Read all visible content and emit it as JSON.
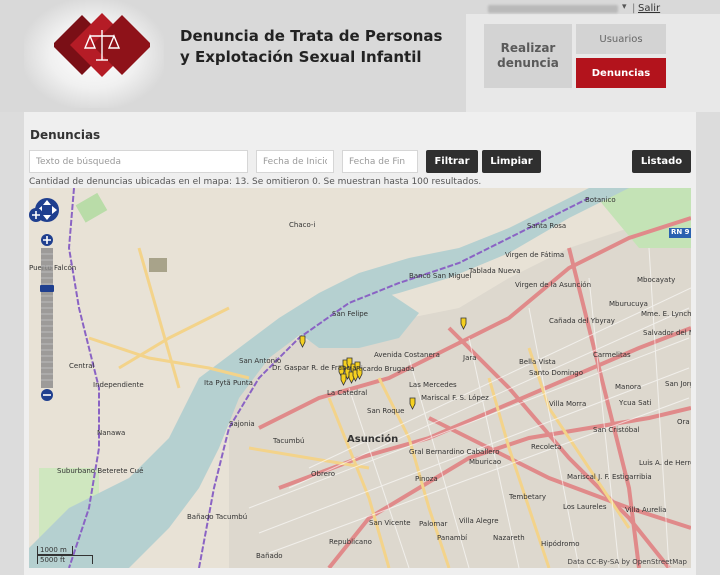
{
  "header": {
    "title_line1": "Denuncia de Trata de Personas",
    "title_line2": "y Explotación Sexual Infantil",
    "logout_label": "Salir",
    "separator": "|",
    "caret": "▾"
  },
  "nav": {
    "realizar_line1": "Realizar",
    "realizar_line2": "denuncia",
    "usuarios_label": "Usuarios",
    "denuncias_label": "Denuncias",
    "active_color": "#b3131c"
  },
  "page": {
    "title": "Denuncias",
    "search_placeholder": "Texto de búsqueda",
    "start_placeholder": "Fecha de Inicio",
    "end_placeholder": "Fecha de Fin",
    "filter_label": "Filtrar",
    "clear_label": "Limpiar",
    "list_label": "Listado",
    "info_text": "Cantidad de denuncias ubicadas en el mapa: 13. Se omitieron 0. Se muestran hasta 100 resultados."
  },
  "map": {
    "labels": {
      "asuncion": "Asunción",
      "botanico": "Botanico",
      "santa_rosa": "Santa Rosa",
      "chaco_i": "Chaco-i",
      "banco_san_miguel": "Banco San Miguel",
      "tablada_nueva": "Tablada Nueva",
      "virgen_fatima": "Virgen de Fátima",
      "virgen_asuncion": "Virgen de la Asunción",
      "mburucuya": "Mburucuya",
      "san_felipe": "San Felipe",
      "san_antonio": "San Antonio",
      "gaspar": "Dr. Gaspar R. de Francia",
      "ricardo_brugada": "Ricardo Brugada",
      "la_catedral": "La Catedral",
      "san_roque": "San Roque",
      "las_mercedes": "Las Mercedes",
      "jara": "Jara",
      "bella_vista": "Bella Vista",
      "santo_domingo": "Santo Domingo",
      "carmelitas": "Carmelitas",
      "manora": "Manora",
      "villa_morra": "Villa Morra",
      "ycua_sati": "Ycua Sati",
      "recoleta": "Recoleta",
      "san_cristobal": "San Cristóbal",
      "sajonia": "Sajonia",
      "tacumbu": "Tacumbú",
      "obrero": "Obrero",
      "pinoza": "Pinoza",
      "mburicao": "Mburicao",
      "tembetary": "Tembetary",
      "mariscal_estigarribia": "Mariscal J. F. Estigarribia",
      "los_laureles": "Los Laureles",
      "villa_aurelia": "Villa Aurelia",
      "banado_tacumbu": "Bañado Tacumbú",
      "republicano": "Republicano",
      "san_vicente": "San Vicente",
      "villa_alegre": "Villa Alegre",
      "nazareth": "Nazareth",
      "hipodromo": "Hipódromo",
      "banado": "Bañado",
      "bernardino": "Gral Bernardino Caballero",
      "itapyta": "Ita Pytã Punta",
      "central": "Central",
      "independiente": "Independiente",
      "nanawa": "Nanawa",
      "suburbano": "Suburbano Beterete Cué",
      "mbocayaty": "Mbocayaty",
      "mme_lynch": "Mme. E. Lynch",
      "salvador": "Salvador del Mundo",
      "canada": "Cañada del Ybyray",
      "san_jorge": "San Jorge",
      "ex_lopez": "Mariscal F. S. López",
      "luis_herrera": "Luis A. de Herrera",
      "palomar": "Palomar",
      "panambi": "Panambí",
      "costanera": "Avenida Costanera",
      "rn9": "RN 9",
      "puerto_falcon": "Puerto Falcón",
      "ora": "Ora"
    },
    "markers_count": 13,
    "scale_m": "1000 m",
    "scale_ft": "5000 ft",
    "attribution": "Data CC-By-SA by OpenStreetMap"
  }
}
